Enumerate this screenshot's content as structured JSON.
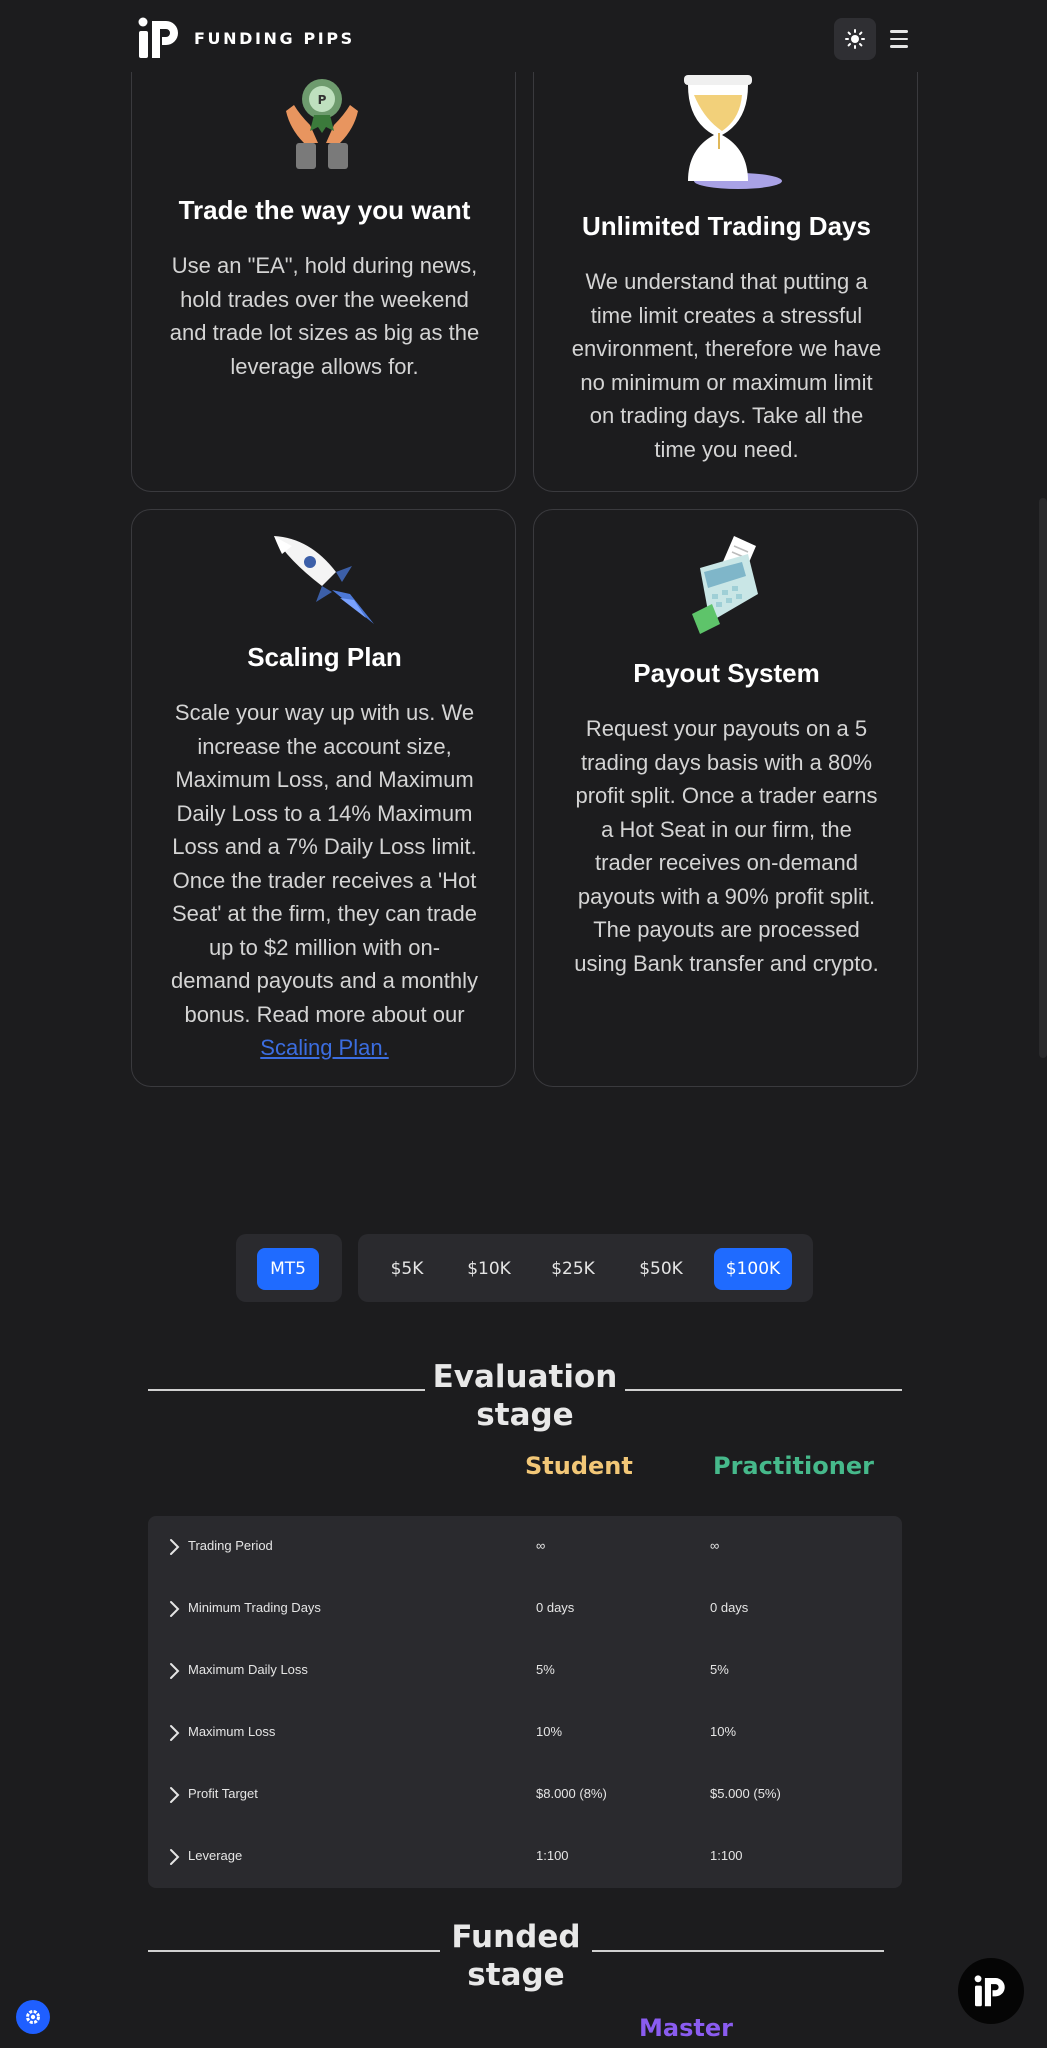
{
  "header": {
    "brand": "FUNDING PIPS",
    "theme_icon": "sun-icon",
    "menu_icon": "hamburger-icon"
  },
  "features": [
    {
      "icon": "hands-award-icon",
      "title": "Trade the way you want",
      "lines": [
        "Use an \"EA\", hold during news,",
        "hold trades over the weekend",
        "and trade lot sizes as big as the",
        "leverage allows for."
      ]
    },
    {
      "icon": "hourglass-icon",
      "title": "Unlimited Trading Days",
      "lines": [
        "We understand that putting a",
        "time limit creates a stressful",
        "environment, therefore we have",
        "no minimum or maximum limit",
        "on trading days. Take all the",
        "time you need."
      ]
    },
    {
      "icon": "rocket-icon",
      "title": "Scaling Plan",
      "lines": [
        "Scale your way up with us. We",
        "increase the account size,",
        "Maximum Loss, and Maximum",
        "Daily Loss to a 14% Maximum",
        "Loss and a 7% Daily Loss limit.",
        "Once the trader receives a 'Hot",
        "Seat' at the firm, they can trade",
        "up to $2 million with on-",
        "demand payouts and a monthly",
        "bonus. Read more about our"
      ],
      "link": "Scaling Plan."
    },
    {
      "icon": "card-terminal-icon",
      "title": "Payout System",
      "lines": [
        "Request your payouts on a 5",
        "trading days basis with a 80%",
        "profit split. Once a trader earns",
        "a Hot Seat in our firm, the",
        "trader receives on-demand",
        "payouts with a 90% profit split.",
        "The payouts are processed",
        "using Bank transfer and crypto."
      ]
    }
  ],
  "platforms": [
    "MT5"
  ],
  "selected_platform": "MT5",
  "account_sizes": [
    "$5K",
    "$10K",
    "$25K",
    "$50K",
    "$100K"
  ],
  "selected_size": "$100K",
  "evaluation": {
    "title_line1": "Evaluation",
    "title_line2": "stage",
    "plans": [
      {
        "name": "Student",
        "color": "#f2c777"
      },
      {
        "name": "Practitioner",
        "color": "#46b98b"
      }
    ],
    "rows": [
      {
        "label": "Trading Period",
        "student": "∞",
        "practitioner": "∞"
      },
      {
        "label": "Minimum Trading Days",
        "student": "0 days",
        "practitioner": "0 days"
      },
      {
        "label": "Maximum Daily Loss",
        "student": "5%",
        "practitioner": "5%"
      },
      {
        "label": "Maximum Loss",
        "student": "10%",
        "practitioner": "10%"
      },
      {
        "label": "Profit Target",
        "student": "$8.000 (8%)",
        "practitioner": "$5.000 (5%)"
      },
      {
        "label": "Leverage",
        "student": "1:100",
        "practitioner": "1:100"
      }
    ]
  },
  "funded": {
    "title_line1": "Funded",
    "title_line2": "stage",
    "plan": {
      "name": "Master",
      "color": "#8a5cf0"
    }
  },
  "fab_icon": "fundingpips-logo-icon",
  "settings_icon": "gear-icon",
  "colors": {
    "accent": "#1f6bff",
    "background": "#1c1c1e",
    "link": "#3b6de0"
  }
}
